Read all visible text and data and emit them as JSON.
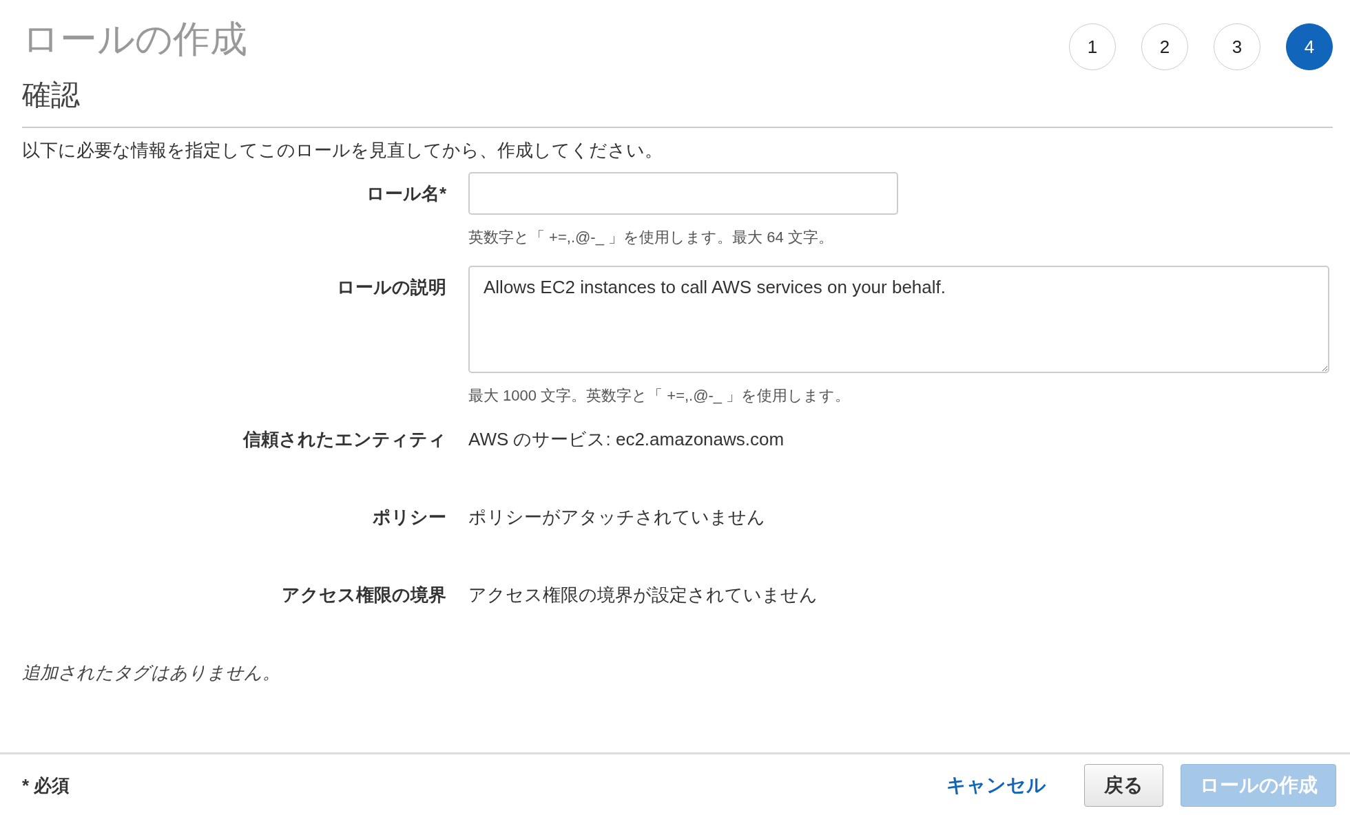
{
  "title": "ロールの作成",
  "steps": [
    {
      "label": "1",
      "selected": false
    },
    {
      "label": "2",
      "selected": false
    },
    {
      "label": "3",
      "selected": false
    },
    {
      "label": "4",
      "selected": true
    }
  ],
  "section": {
    "heading": "確認",
    "intro": "以下に必要な情報を指定してこのロールを見直してから、作成してください。"
  },
  "fields": [
    {
      "kind": "input",
      "label": "ロール名*",
      "hint": "英数字と「 +=,.@-_ 」を使用します。最大 64 文字。"
    },
    {
      "kind": "textarea",
      "label": "ロールの説明",
      "value": "Allows EC2 instances to call AWS services on your behalf.",
      "hint": "最大 1000 文字。英数字と「 +=,.@-_ 」を使用します。"
    },
    {
      "kind": "text",
      "label": "信頼されたエンティティ",
      "value": "AWS のサービス: ec2.amazonaws.com"
    },
    {
      "kind": "text",
      "label": "ポリシー",
      "value": "ポリシーがアタッチされていません"
    },
    {
      "kind": "text",
      "label": "アクセス権限の境界",
      "value": "アクセス権限の境界が設定されていません"
    }
  ],
  "tags_note": "追加されたタグはありません。",
  "footer": {
    "required_note": "* 必須",
    "cancel": "キャンセル",
    "back": "戻る",
    "create": {
      "label": "ロールの作成",
      "disabled": true
    }
  }
}
